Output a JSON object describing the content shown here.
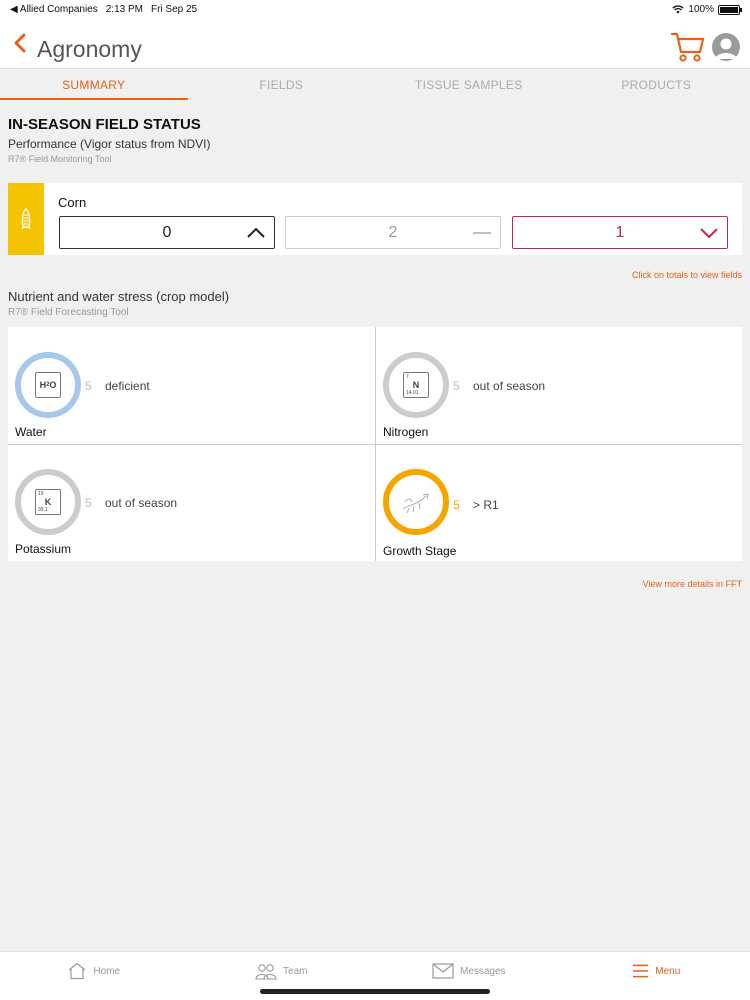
{
  "status_bar": {
    "carrier": "◀ Allied Companies",
    "time": "2:13 PM",
    "date": "Fri Sep 25",
    "battery": "100%",
    "battery_level": 1.0
  },
  "header": {
    "title": "Agronomy",
    "back_icon": "chevron-left-icon",
    "cart_icon": "cart-icon",
    "avatar_icon": "user-avatar-icon"
  },
  "tabs": [
    {
      "label": "SUMMARY",
      "active": true
    },
    {
      "label": "FIELDS",
      "active": false
    },
    {
      "label": "TISSUE SAMPLES",
      "active": false
    },
    {
      "label": "PRODUCTS",
      "active": false
    }
  ],
  "in_season": {
    "title": "IN-SEASON FIELD STATUS",
    "subtitle": "Performance (Vigor status from NDVI)",
    "tool": "R7® Field Monitoring Tool",
    "crop": "Corn",
    "totals": [
      {
        "value": "0",
        "trend": "up"
      },
      {
        "value": "2",
        "trend": "flat"
      },
      {
        "value": "1",
        "trend": "down"
      }
    ],
    "hint": "Click on totals to view fields"
  },
  "nutrient": {
    "title": "Nutrient and water stress (crop model)",
    "tool": "R7® Field Forecasting Tool",
    "items": [
      {
        "label": "Water",
        "count": "5",
        "status": "deficient"
      },
      {
        "label": "Nitrogen",
        "count": "5",
        "status": "out of season"
      },
      {
        "label": "Potassium",
        "count": "5",
        "status": "out of season"
      },
      {
        "label": "Growth Stage",
        "count": "5",
        "status": "> R1"
      }
    ],
    "fft_link": "View more details in FFT"
  },
  "bottom_nav": [
    {
      "label": "Home",
      "icon": "home-icon"
    },
    {
      "label": "Team",
      "icon": "team-icon"
    },
    {
      "label": "Messages",
      "icon": "messages-icon"
    },
    {
      "label": "Menu",
      "icon": "menu-icon",
      "active": true
    }
  ],
  "colors": {
    "accent": "#e2621b",
    "crop_strip": "#f5c400",
    "down": "#c0284a",
    "water_ring": "#a8c8ea",
    "growth_ring": "#f5a500"
  }
}
